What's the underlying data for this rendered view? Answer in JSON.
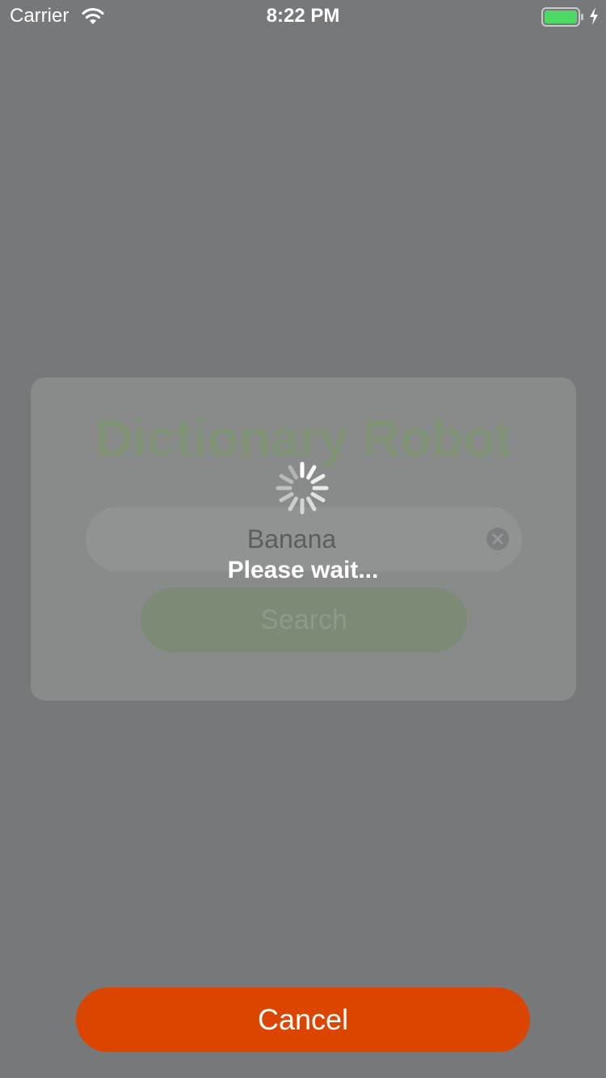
{
  "status_bar": {
    "carrier": "Carrier",
    "time": "8:22 PM",
    "battery_color": "#4cd964"
  },
  "card": {
    "title": "Dictionary Robot",
    "search": {
      "value": "Banana",
      "clear_icon": "clear-circle-icon"
    },
    "search_button_label": "Search"
  },
  "overlay": {
    "spinner_icon": "activity-spinner-icon",
    "message": "Please wait..."
  },
  "cancel_button_label": "Cancel",
  "colors": {
    "background": "#77787a",
    "accent_green": "#819377",
    "cancel": "#db4500"
  }
}
